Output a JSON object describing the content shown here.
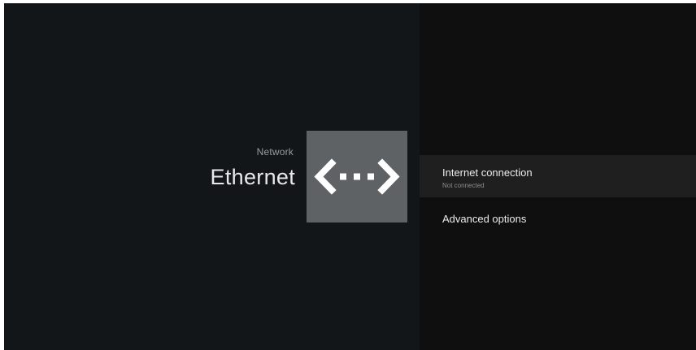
{
  "header": {
    "breadcrumb": "Network",
    "title": "Ethernet",
    "icon": "ethernet-icon"
  },
  "menu": {
    "items": [
      {
        "title": "Internet connection",
        "subtitle": "Not connected",
        "selected": true
      },
      {
        "title": "Advanced options",
        "subtitle": "",
        "selected": false
      }
    ]
  },
  "colors": {
    "left_background": "#121619",
    "right_background": "#0f0f0f",
    "icon_tile": "#5f6264",
    "selected_row": "#1f1f1f"
  }
}
